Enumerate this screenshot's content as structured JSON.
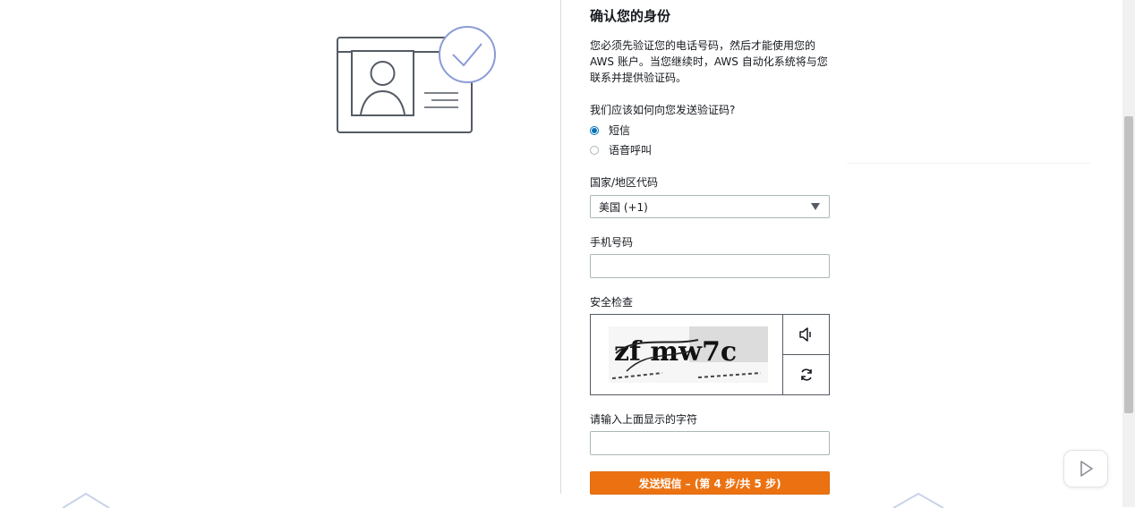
{
  "form": {
    "title": "确认您的身份",
    "description": "您必须先验证您的电话号码，然后才能使用您的 AWS 账户。当您继续时，AWS 自动化系统将与您联系并提供验证码。",
    "question": "我们应该如何向您发送验证码?",
    "options": [
      {
        "label": "短信",
        "checked": true
      },
      {
        "label": "语音呼叫",
        "checked": false
      }
    ],
    "country_label": "国家/地区代码",
    "country_value": "美国 (+1)",
    "phone_label": "手机号码",
    "phone_value": "",
    "security_label": "安全检查",
    "captcha_text": "zf mw7c",
    "chars_label": "请输入上面显示的字符",
    "chars_value": "",
    "submit_label": "发送短信 – (第 4 步/共 5 步)"
  },
  "icons": {
    "illustration": "id-card-verified-illustration",
    "audio": "speaker-icon",
    "refresh": "refresh-icon",
    "float": "video-play-icon",
    "caret": "caret-down-icon"
  },
  "colors": {
    "accent": "#0073bb",
    "primary_button": "#ec7211",
    "illustration_check": "#8b9bd6",
    "text": "#16191f",
    "border": "#aab7b8"
  }
}
